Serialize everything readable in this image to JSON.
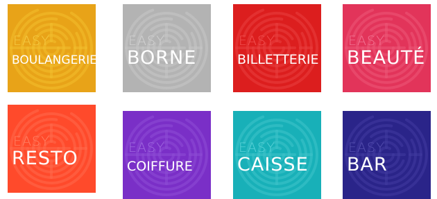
{
  "tiles": [
    {
      "brand": "EASY",
      "product": "BOULANGERIE",
      "bg": "#E8A318",
      "brand_color": "#F5CC45",
      "maze_color": "#F2C02E"
    },
    {
      "brand": "EASY",
      "product": "BORNE",
      "bg": "#B3B3B3",
      "brand_color": "#D2D2D2",
      "maze_color": "#C6C6C6"
    },
    {
      "brand": "EASY",
      "product": "BILLETTERIE",
      "bg": "#DC1E1E",
      "brand_color": "#F25151",
      "maze_color": "#E94040"
    },
    {
      "brand": "EASY",
      "product": "BEAUTÉ",
      "bg": "#E2345A",
      "brand_color": "#F27594",
      "maze_color": "#EC5878"
    },
    {
      "brand": "EASY",
      "product": "RESTO",
      "bg": "#FF4A2B",
      "brand_color": "#FF8266",
      "maze_color": "#FF6A4D"
    },
    {
      "brand": "EASY",
      "product": "COIFFURE",
      "bg": "#7A2FC7",
      "brand_color": "#A06BE0",
      "maze_color": "#8E4DD6"
    },
    {
      "brand": "EASY",
      "product": "CAISSE",
      "bg": "#18B0B8",
      "brand_color": "#5BD3D9",
      "maze_color": "#3FC4CB"
    },
    {
      "brand": "EASY",
      "product": "BAR",
      "bg": "#2A2489",
      "brand_color": "#5550B0",
      "maze_color": "#413BA0"
    }
  ]
}
